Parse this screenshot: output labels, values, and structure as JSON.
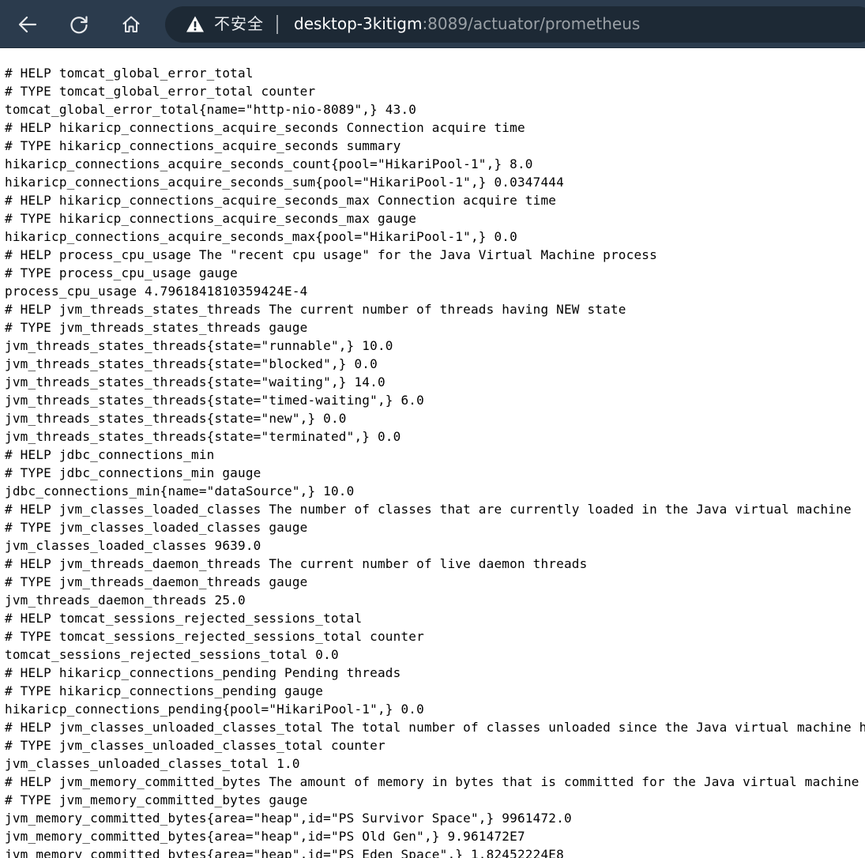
{
  "browser": {
    "security_label": "不安全",
    "url_host": "desktop-3kitigm",
    "url_rest": ":8089/actuator/prometheus",
    "icons": {
      "back": "back-arrow-icon",
      "reload": "reload-icon",
      "home": "home-icon",
      "security": "warning-icon"
    },
    "colors": {
      "toolbar": "#2b3b4d",
      "omnibox": "#1d2935"
    }
  },
  "metrics": {
    "lines": [
      "# HELP tomcat_global_error_total",
      "# TYPE tomcat_global_error_total counter",
      "tomcat_global_error_total{name=\"http-nio-8089\",} 43.0",
      "# HELP hikaricp_connections_acquire_seconds Connection acquire time",
      "# TYPE hikaricp_connections_acquire_seconds summary",
      "hikaricp_connections_acquire_seconds_count{pool=\"HikariPool-1\",} 8.0",
      "hikaricp_connections_acquire_seconds_sum{pool=\"HikariPool-1\",} 0.0347444",
      "# HELP hikaricp_connections_acquire_seconds_max Connection acquire time",
      "# TYPE hikaricp_connections_acquire_seconds_max gauge",
      "hikaricp_connections_acquire_seconds_max{pool=\"HikariPool-1\",} 0.0",
      "# HELP process_cpu_usage The \"recent cpu usage\" for the Java Virtual Machine process",
      "# TYPE process_cpu_usage gauge",
      "process_cpu_usage 4.7961841810359424E-4",
      "# HELP jvm_threads_states_threads The current number of threads having NEW state",
      "# TYPE jvm_threads_states_threads gauge",
      "jvm_threads_states_threads{state=\"runnable\",} 10.0",
      "jvm_threads_states_threads{state=\"blocked\",} 0.0",
      "jvm_threads_states_threads{state=\"waiting\",} 14.0",
      "jvm_threads_states_threads{state=\"timed-waiting\",} 6.0",
      "jvm_threads_states_threads{state=\"new\",} 0.0",
      "jvm_threads_states_threads{state=\"terminated\",} 0.0",
      "# HELP jdbc_connections_min",
      "# TYPE jdbc_connections_min gauge",
      "jdbc_connections_min{name=\"dataSource\",} 10.0",
      "# HELP jvm_classes_loaded_classes The number of classes that are currently loaded in the Java virtual machine",
      "# TYPE jvm_classes_loaded_classes gauge",
      "jvm_classes_loaded_classes 9639.0",
      "# HELP jvm_threads_daemon_threads The current number of live daemon threads",
      "# TYPE jvm_threads_daemon_threads gauge",
      "jvm_threads_daemon_threads 25.0",
      "# HELP tomcat_sessions_rejected_sessions_total",
      "# TYPE tomcat_sessions_rejected_sessions_total counter",
      "tomcat_sessions_rejected_sessions_total 0.0",
      "# HELP hikaricp_connections_pending Pending threads",
      "# TYPE hikaricp_connections_pending gauge",
      "hikaricp_connections_pending{pool=\"HikariPool-1\",} 0.0",
      "# HELP jvm_classes_unloaded_classes_total The total number of classes unloaded since the Java virtual machine ha",
      "# TYPE jvm_classes_unloaded_classes_total counter",
      "jvm_classes_unloaded_classes_total 1.0",
      "# HELP jvm_memory_committed_bytes The amount of memory in bytes that is committed for the Java virtual machine t",
      "# TYPE jvm_memory_committed_bytes gauge",
      "jvm_memory_committed_bytes{area=\"heap\",id=\"PS Survivor Space\",} 9961472.0",
      "jvm_memory_committed_bytes{area=\"heap\",id=\"PS Old Gen\",} 9.961472E7",
      "jvm_memory_committed_bytes{area=\"heap\",id=\"PS Eden Space\",} 1.82452224E8"
    ]
  }
}
